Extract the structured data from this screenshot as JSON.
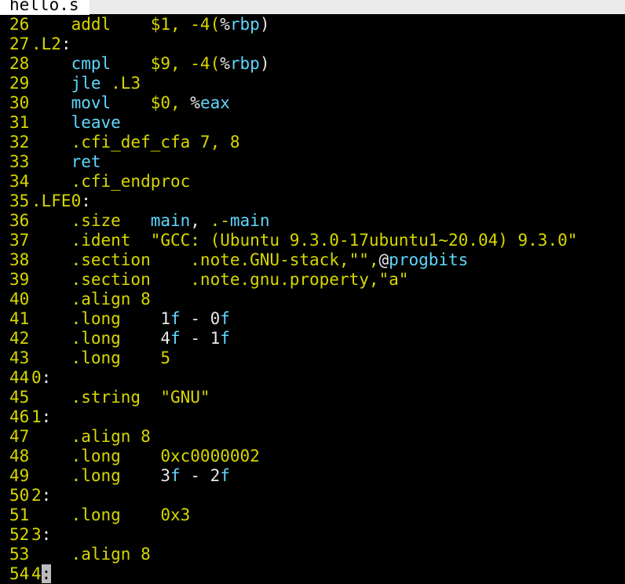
{
  "tab": {
    "filename": "hello.s"
  },
  "colors": {
    "background": "#000000",
    "line_number": "#d7d700",
    "keyword_yellow": "#d7d700",
    "identifier_cyan": "#5fd7ff",
    "plain_text": "#e8e8e8",
    "cursor": "#bcbcbc"
  },
  "lines": [
    {
      "num": "26",
      "segs": [
        [
          "y",
          "    addl    $1, -4("
        ],
        [
          "w",
          "%"
        ],
        [
          "c",
          "rbp"
        ],
        [
          "w",
          ")"
        ]
      ]
    },
    {
      "num": "27",
      "segs": [
        [
          "y",
          ".L2"
        ],
        [
          "w",
          ":"
        ]
      ]
    },
    {
      "num": "28",
      "segs": [
        [
          "c",
          "    cmpl    "
        ],
        [
          "y",
          "$9, -4("
        ],
        [
          "w",
          "%"
        ],
        [
          "c",
          "rbp"
        ],
        [
          "w",
          ")"
        ]
      ]
    },
    {
      "num": "29",
      "segs": [
        [
          "c",
          "    jle "
        ],
        [
          "y",
          ".L3"
        ]
      ]
    },
    {
      "num": "30",
      "segs": [
        [
          "c",
          "    movl    "
        ],
        [
          "y",
          "$0, "
        ],
        [
          "w",
          "%"
        ],
        [
          "c",
          "eax"
        ]
      ]
    },
    {
      "num": "31",
      "segs": [
        [
          "c",
          "    leave"
        ]
      ]
    },
    {
      "num": "32",
      "segs": [
        [
          "y",
          "    .cfi_def_cfa 7, 8"
        ]
      ]
    },
    {
      "num": "33",
      "segs": [
        [
          "c",
          "    ret"
        ]
      ]
    },
    {
      "num": "34",
      "segs": [
        [
          "y",
          "    .cfi_endproc"
        ]
      ]
    },
    {
      "num": "35",
      "segs": [
        [
          "y",
          ".LFE0"
        ],
        [
          "w",
          ":"
        ]
      ]
    },
    {
      "num": "36",
      "segs": [
        [
          "y",
          "    .size   "
        ],
        [
          "c",
          "main"
        ],
        [
          "w",
          ", "
        ],
        [
          "y",
          ".-"
        ],
        [
          "c",
          "main"
        ]
      ]
    },
    {
      "num": "37",
      "segs": [
        [
          "y",
          "    .ident  \"GCC: (Ubuntu 9.3.0-17ubuntu1~20.04) 9.3.0\""
        ]
      ]
    },
    {
      "num": "38",
      "segs": [
        [
          "y",
          "    .section    .note.GNU-stack,\"\","
        ],
        [
          "w",
          "@"
        ],
        [
          "c",
          "progbits"
        ]
      ]
    },
    {
      "num": "39",
      "segs": [
        [
          "y",
          "    .section    .note.gnu.property,\"a\""
        ]
      ]
    },
    {
      "num": "40",
      "segs": [
        [
          "y",
          "    .align 8"
        ]
      ]
    },
    {
      "num": "41",
      "segs": [
        [
          "y",
          "    .long    "
        ],
        [
          "w",
          "1"
        ],
        [
          "c",
          "f"
        ],
        [
          "w",
          " - "
        ],
        [
          "w",
          "0"
        ],
        [
          "c",
          "f"
        ]
      ]
    },
    {
      "num": "42",
      "segs": [
        [
          "y",
          "    .long    "
        ],
        [
          "w",
          "4"
        ],
        [
          "c",
          "f"
        ],
        [
          "w",
          " - "
        ],
        [
          "w",
          "1"
        ],
        [
          "c",
          "f"
        ]
      ]
    },
    {
      "num": "43",
      "segs": [
        [
          "y",
          "    .long    5"
        ]
      ]
    },
    {
      "num": "44",
      "segs": [
        [
          "y",
          "0"
        ],
        [
          "w",
          ":"
        ]
      ]
    },
    {
      "num": "45",
      "segs": [
        [
          "y",
          "    .string  \"GNU\""
        ]
      ]
    },
    {
      "num": "46",
      "segs": [
        [
          "y",
          "1"
        ],
        [
          "w",
          ":"
        ]
      ]
    },
    {
      "num": "47",
      "segs": [
        [
          "y",
          "    .align 8"
        ]
      ]
    },
    {
      "num": "48",
      "segs": [
        [
          "y",
          "    .long    0xc0000002"
        ]
      ]
    },
    {
      "num": "49",
      "segs": [
        [
          "y",
          "    .long    "
        ],
        [
          "w",
          "3"
        ],
        [
          "c",
          "f"
        ],
        [
          "w",
          " - "
        ],
        [
          "w",
          "2"
        ],
        [
          "c",
          "f"
        ]
      ]
    },
    {
      "num": "50",
      "segs": [
        [
          "y",
          "2"
        ],
        [
          "w",
          ":"
        ]
      ]
    },
    {
      "num": "51",
      "segs": [
        [
          "y",
          "    .long    0x3"
        ]
      ]
    },
    {
      "num": "52",
      "segs": [
        [
          "y",
          "3"
        ],
        [
          "w",
          ":"
        ]
      ]
    },
    {
      "num": "53",
      "segs": [
        [
          "y",
          "    .align 8"
        ]
      ]
    },
    {
      "num": "54",
      "segs": [
        [
          "y",
          "4"
        ],
        [
          "cursor",
          ":"
        ]
      ]
    }
  ]
}
